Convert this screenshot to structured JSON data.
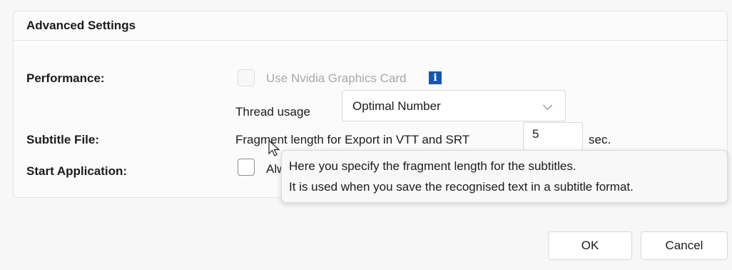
{
  "group": {
    "title": "Advanced Settings"
  },
  "performance": {
    "label": "Performance:",
    "nvidia_label": "Use Nvidia Graphics Card",
    "nvidia_checked": false,
    "nvidia_enabled": false,
    "info_icon": "info-icon",
    "thread_label": "Thread usage",
    "thread_value": "Optimal Number"
  },
  "subtitle": {
    "label": "Subtitle File:",
    "fragment_label": "Fragment length for Export in VTT and SRT",
    "fragment_value": "5",
    "unit": "sec."
  },
  "start": {
    "label": "Start Application:",
    "checkbox_label_partial": "Alw"
  },
  "tooltip": {
    "line1": "Here you specify the fragment length for the subtitles.",
    "line2": "It is used when you save the recognised text in a subtitle format."
  },
  "buttons": {
    "ok": "OK",
    "cancel": "Cancel"
  },
  "colors": {
    "info_icon": "#1456b4"
  }
}
